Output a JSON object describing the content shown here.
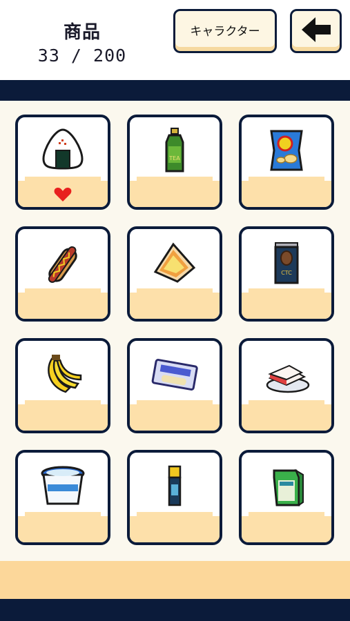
{
  "header": {
    "title": "商品",
    "count": "33 / 200"
  },
  "buttons": {
    "character": "キャラクター",
    "back_icon": "left-arrow-icon"
  },
  "colors": {
    "navy": "#0b1b3a",
    "cream": "#fbf8ee",
    "peach": "#fde0aa",
    "orange_bar": "#fcd79a",
    "heart": "#e8201e"
  },
  "items": [
    {
      "icon": "onigiri-icon",
      "favorite": true
    },
    {
      "icon": "green-tea-bottle-icon",
      "favorite": false
    },
    {
      "icon": "potato-chips-bag-icon",
      "favorite": false
    },
    {
      "icon": "hot-dog-icon",
      "favorite": false
    },
    {
      "icon": "sandwich-icon",
      "favorite": false
    },
    {
      "icon": "coffee-can-icon",
      "favorite": false
    },
    {
      "icon": "banana-bunch-icon",
      "favorite": false
    },
    {
      "icon": "packaged-bread-icon",
      "favorite": false
    },
    {
      "icon": "cake-slice-icon",
      "favorite": false
    },
    {
      "icon": "ice-cream-cup-icon",
      "favorite": false
    },
    {
      "icon": "glue-stick-icon",
      "favorite": false
    },
    {
      "icon": "milk-carton-icon",
      "favorite": false
    }
  ]
}
